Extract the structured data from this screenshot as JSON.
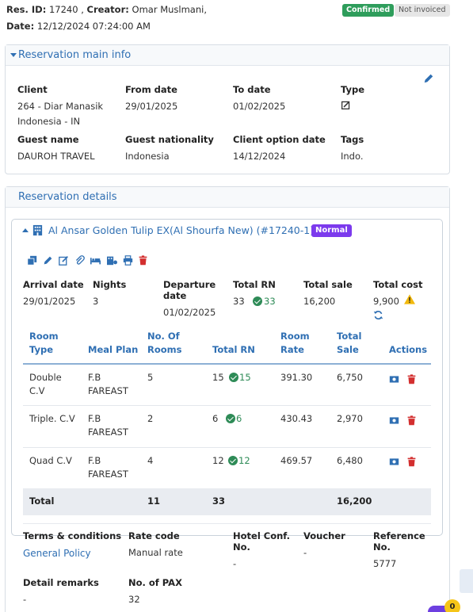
{
  "header": {
    "res_id_label": "Res. ID:",
    "res_id_value": "17240 ,",
    "creator_label": "Creator:",
    "creator_value": "Omar Muslmani,",
    "date_label": "Date:",
    "date_value": "12/12/2024 07:24:00 AM",
    "status_badge": "Confirmed",
    "invoice_badge": "Not invoiced"
  },
  "main_info": {
    "title": "Reservation main info",
    "fields": {
      "client_label": "Client",
      "client_line1": "264 - Diar Manasik",
      "client_line2": "Indonesia - IN",
      "from_label": "From date",
      "from_value": "29/01/2025",
      "to_label": "To date",
      "to_value": "01/02/2025",
      "type_label": "Type",
      "guest_label": "Guest name",
      "guest_value": "DAUROH TRAVEL",
      "nationality_label": "Guest nationality",
      "nationality_value": "Indonesia",
      "option_label": "Client option date",
      "option_value": "14/12/2024",
      "tags_label": "Tags",
      "tags_value": "Indo."
    }
  },
  "details": {
    "title": "Reservation details",
    "hotel": {
      "name": "Al Ansar Golden Tulip EX(Al Shourfa New)  (#17240-1)",
      "badge": "Normal",
      "summary": {
        "arrival_label": "Arrival date",
        "arrival_value": "29/01/2025",
        "nights_label": "Nights",
        "nights_value": "3",
        "departure_label_1": "Departure",
        "departure_label_2": "date",
        "departure_value": "01/02/2025",
        "total_rn_label": "Total RN",
        "total_rn_value": "33",
        "total_rn_confirmed": "33",
        "total_sale_label": "Total sale",
        "total_sale_value": "16,200",
        "total_cost_label": "Total cost",
        "total_cost_value": "9,900"
      },
      "table": {
        "headers": {
          "room_type_1": "Room",
          "room_type_2": "Type",
          "meal_plan": "Meal Plan",
          "rooms_1": "No. Of",
          "rooms_2": "Rooms",
          "total_rn": "Total RN",
          "rate_1": "Room",
          "rate_2": "Rate",
          "sale_1": "Total",
          "sale_2": "Sale",
          "actions": "Actions"
        },
        "rows": [
          {
            "type_1": "Double",
            "type_2": "C.V",
            "meal_1": "F.B",
            "meal_2": "FAREAST",
            "rooms": "5",
            "rn": "15",
            "rn_confirmed": "15",
            "rate": "391.30",
            "sale": "6,750"
          },
          {
            "type_1": "Triple. C.V",
            "type_2": "",
            "meal_1": "F.B",
            "meal_2": "FAREAST",
            "rooms": "2",
            "rn": "6",
            "rn_confirmed": "6",
            "rate": "430.43",
            "sale": "2,970"
          },
          {
            "type_1": "Quad C.V",
            "type_2": "",
            "meal_1": "F.B",
            "meal_2": "FAREAST",
            "rooms": "4",
            "rn": "12",
            "rn_confirmed": "12",
            "rate": "469.57",
            "sale": "6,480"
          }
        ],
        "total": {
          "label": "Total",
          "rooms": "11",
          "rn": "33",
          "sale": "16,200"
        }
      },
      "footer": {
        "terms_label": "Terms & conditions",
        "terms_link": "General Policy",
        "rate_code_label": "Rate code",
        "rate_code_value": "Manual rate",
        "conf_label_1": "Hotel Conf.",
        "conf_label_2": "No.",
        "conf_value": "-",
        "voucher_label": "Voucher",
        "voucher_value": "-",
        "reference_label_1": "Reference",
        "reference_label_2": "No.",
        "reference_value": "5777",
        "remarks_label": "Detail remarks",
        "remarks_value": "-",
        "pax_label": "No. of PAX",
        "pax_value": "32"
      }
    }
  },
  "widgets": {
    "notification_count": "0"
  },
  "colors": {
    "accent": "#2f6fb3",
    "confirmed": "#2e9d5b",
    "normal_badge": "#7c3aed",
    "delete": "#d32f2f",
    "warning": "#f2b90c"
  }
}
